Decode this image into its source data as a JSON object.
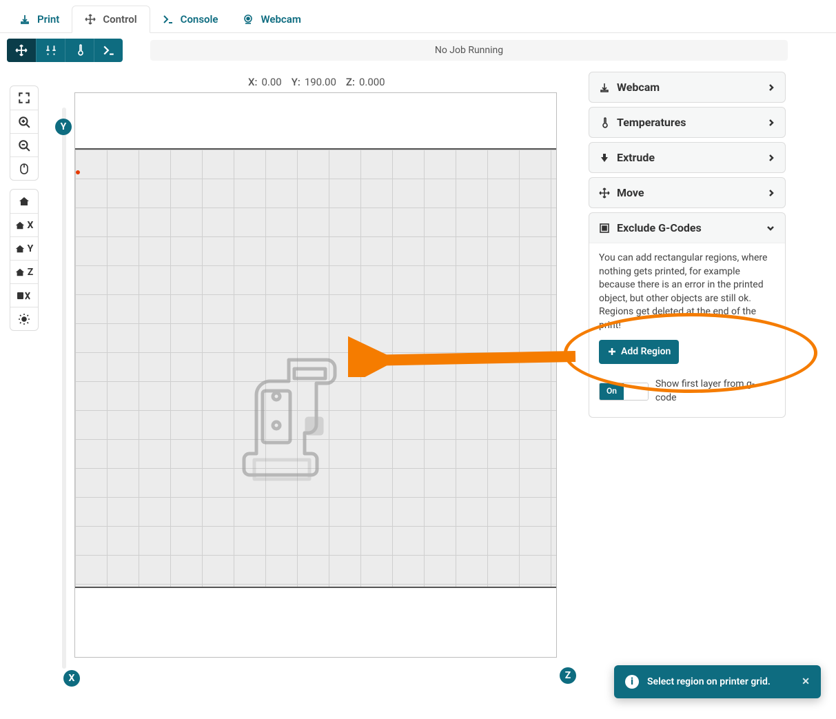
{
  "tabs": {
    "print": "Print",
    "control": "Control",
    "console": "Console",
    "webcam": "Webcam"
  },
  "status_bar": "No Job Running",
  "coords": {
    "x_label": "X:",
    "x_val": "0.00",
    "y_label": "Y:",
    "y_val": "190.00",
    "z_label": "Z:",
    "z_val": "0.000"
  },
  "left_controls": {
    "home_all": "",
    "home_x": "X",
    "home_y": "Y",
    "home_z": "Z"
  },
  "axes": {
    "y": "Y",
    "x": "X",
    "z": "Z"
  },
  "panels": {
    "webcam": "Webcam",
    "temperatures": "Temperatures",
    "extrude": "Extrude",
    "move": "Move",
    "exclude": {
      "title": "Exclude G-Codes",
      "desc": "You can add rectangular regions, where nothing gets printed, for example because there is an error in the printed object, but other objects are still ok. Regions get deleted at the end of the print!",
      "add_region": "Add Region",
      "toggle_on": "On",
      "toggle_off": "",
      "toggle_label": "Show first layer from g-code"
    }
  },
  "toast": {
    "message": "Select region on printer grid.",
    "close": "✕"
  }
}
